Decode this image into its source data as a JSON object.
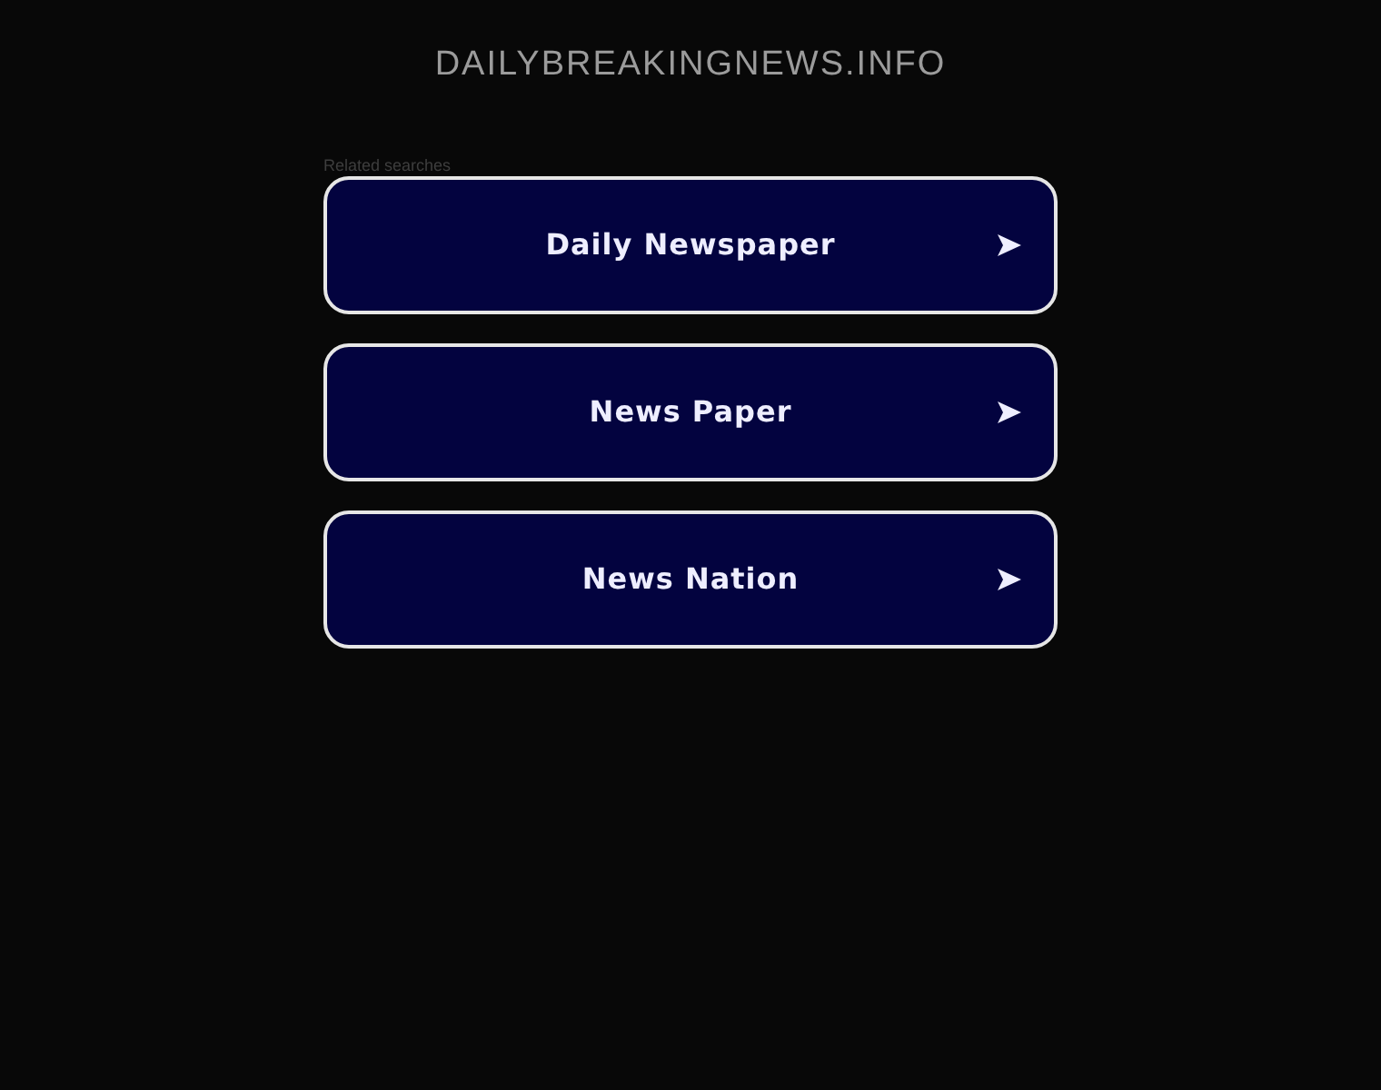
{
  "site_title": "DAILYBREAKINGNEWS.INFO",
  "related_label": "Related searches",
  "links": [
    {
      "label": "Daily Newspaper"
    },
    {
      "label": "News Paper"
    },
    {
      "label": "News Nation"
    }
  ]
}
